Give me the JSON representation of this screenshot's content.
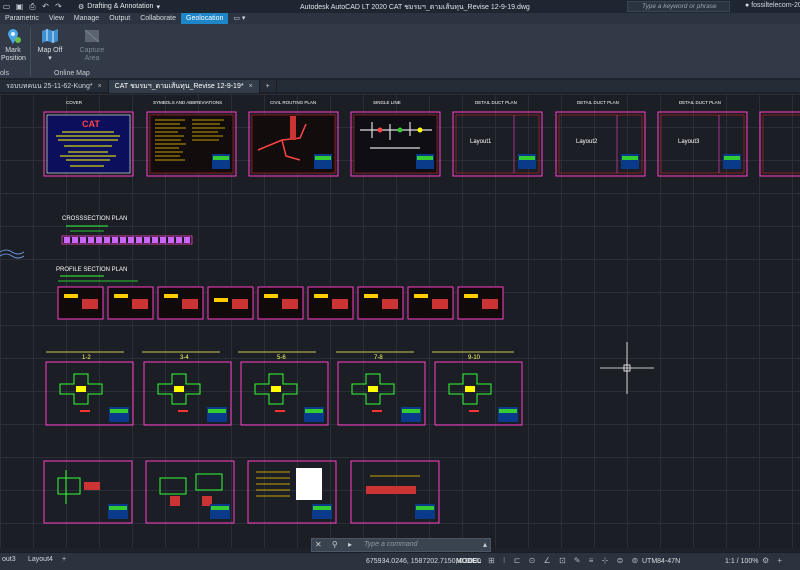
{
  "titlebar": {
    "workspace": "Drafting & Annotation",
    "title": "Autodesk AutoCAD LT 2020   CAT ชมรมฯ_ตามเส้นทุน_Revise 12-9-19.dwg",
    "search_placeholder": "Type a keyword or phrase",
    "user": "fossiltelecom-20"
  },
  "ribbon_tabs": [
    "Parametric",
    "View",
    "Manage",
    "Output",
    "Collaborate",
    "Geolocation"
  ],
  "ribbon_active": "Geolocation",
  "ribbon": {
    "mark_position": "Mark\nPosition",
    "mark_label_1": "Mark",
    "mark_label_2": "Position",
    "map_off": "Map Off",
    "capture_1": "Capture",
    "capture_2": "Area",
    "panel_tools": "ols",
    "panel_map": "Online Map"
  },
  "doc_tabs": [
    {
      "label": "รอบบทคนน 25-11-62-Kung*",
      "active": false
    },
    {
      "label": "CAT ชมรมฯ_ตามเส้นทุน_Revise 12-9-19*",
      "active": true
    }
  ],
  "canvas": {
    "sheet_titles": [
      "COVER",
      "SYMBOLS AND ABBREVIATIONS",
      "CIVIL ROUTING PLAN",
      "SINGLE LINE",
      "DETAIL DUCT PLAN",
      "DETAIL DUCT PLAN",
      "DETAIL DUCT PLAN"
    ],
    "layout_labels": [
      "Layout1",
      "Layout2",
      "Layout3"
    ],
    "crosssection_title": "CROSSSECTION PLAN",
    "profile_title": "PROFILE SECTION PLAN",
    "manhole_labels": [
      "1-2",
      "3-4",
      "5-6",
      "7-8",
      "9-10"
    ],
    "cover_logo": "CAT"
  },
  "command": {
    "placeholder": "Type a command"
  },
  "status": {
    "layout_tabs": [
      "out3",
      "Layout4"
    ],
    "coords": "675934.0246, 1587202.7150, 0.0000",
    "model": "MODEL",
    "utm": "UTM84-47N",
    "scale": "1:1 / 100%"
  },
  "colors": {
    "accent": "#1c86c9",
    "frame": "#ff3ec8",
    "canvas": "#1b1e24"
  }
}
